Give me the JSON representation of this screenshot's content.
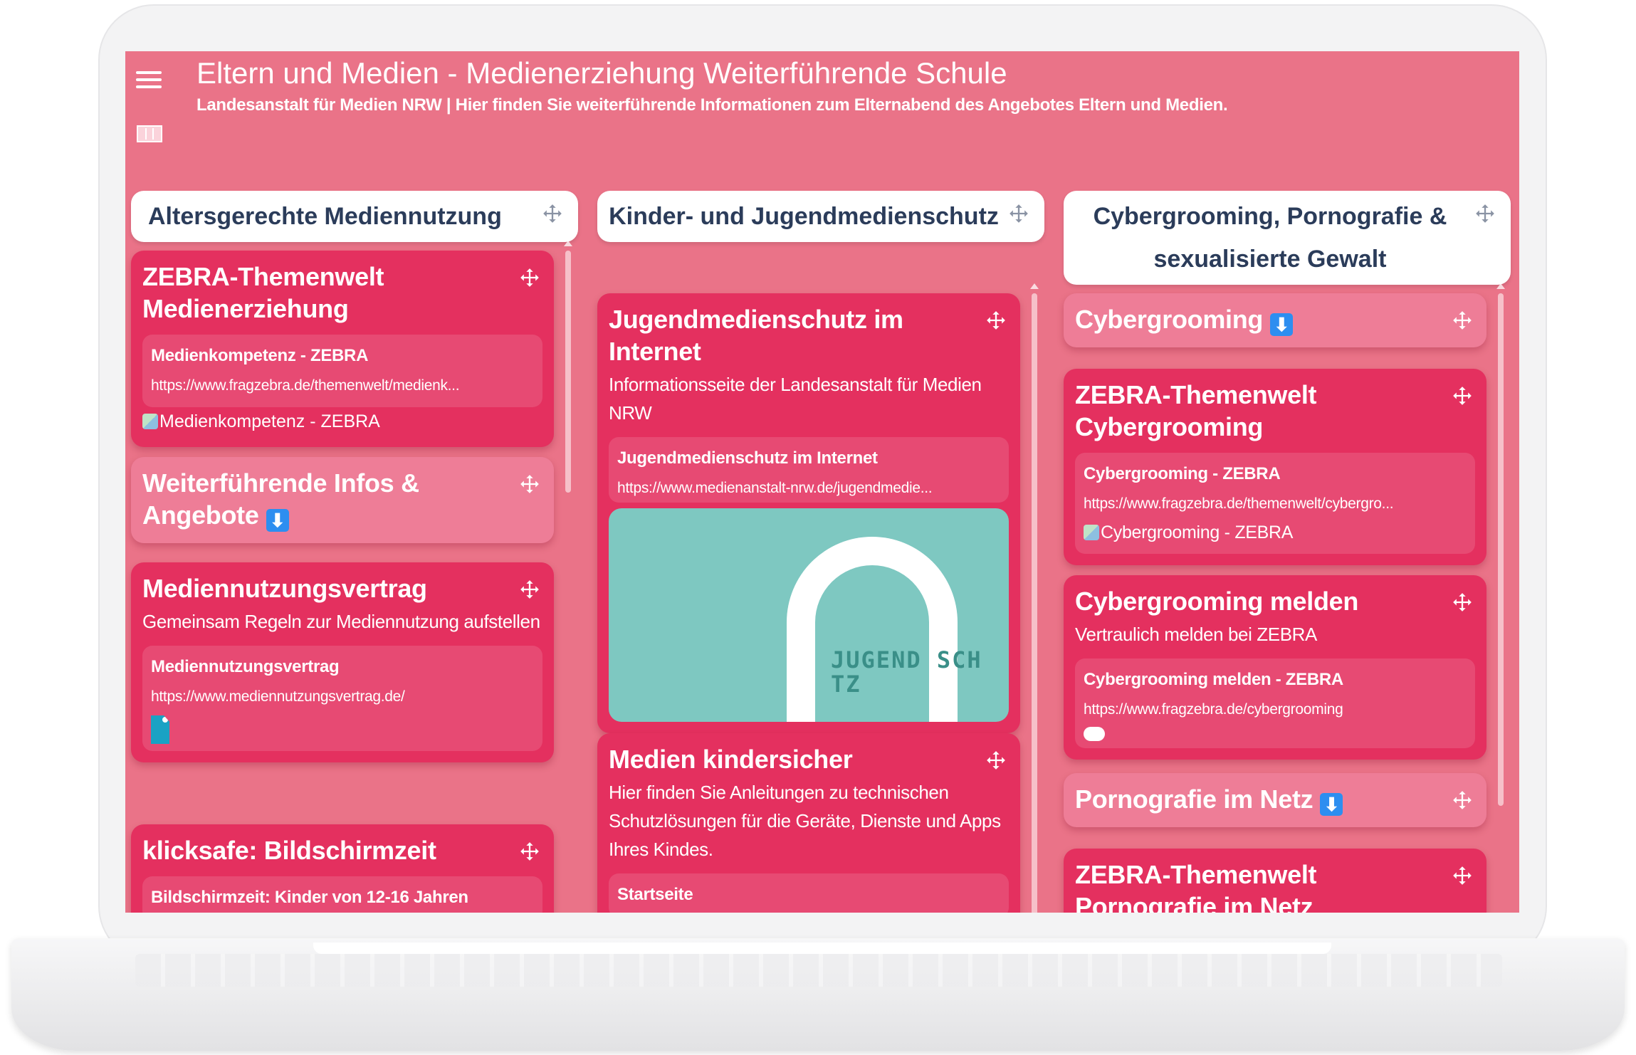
{
  "header": {
    "title": "Eltern und Medien - Medienerziehung Weiterführende Schule",
    "subtitle": "Landesanstalt für Medien NRW | Hier finden Sie weiterführende Informationen zum Elternabend des Angebotes Eltern und Medien."
  },
  "colors": {
    "background": "#ea7388",
    "card": "#e4305f",
    "card_light": "#ee7d97",
    "header_text": "#2b3c5a",
    "badge": "#2d8ef0"
  },
  "columns": [
    {
      "title": "Altersgerechte Mediennutzung",
      "cards": [
        {
          "title": "ZEBRA-Themenwelt Medienerziehung",
          "attachment": {
            "title": "Medienkompetenz - ZEBRA",
            "url": "https://www.fragzebra.de/themenwelt/medienk...",
            "image_alt": "Medienkompetenz - ZEBRA"
          }
        },
        {
          "title": "Weiterführende Infos & Angebote",
          "badge": "⬇"
        },
        {
          "title": "Mediennutzungsvertrag",
          "description": "Gemeinsam Regeln zur Mediennutzung aufstellen",
          "attachment": {
            "title": "Mediennutzungsvertrag",
            "url": "https://www.mediennutzungsvertrag.de/"
          }
        },
        {
          "title": "klicksafe: Bildschirmzeit",
          "attachment": {
            "title": "Bildschirmzeit: Kinder von 12-16 Jahren"
          }
        }
      ]
    },
    {
      "title": "Kinder- und Jugendmedienschutz",
      "cards": [
        {
          "title": "Jugendmedienschutz im Internet",
          "description": "Informationsseite der Landesanstalt für Medien NRW",
          "attachment": {
            "title": "Jugendmedienschutz im Internet",
            "url": "https://www.medienanstalt-nrw.de/jugendmedie...",
            "image_text": "JUGEND SCH TZ"
          }
        },
        {
          "title": "Medien kindersicher",
          "description": "Hier finden Sie Anleitungen zu technischen Schutzlösungen für die Geräte, Dienste und Apps Ihres Kindes.",
          "attachment": {
            "title": "Startseite"
          }
        }
      ]
    },
    {
      "title": "Cybergrooming, Pornografie & sexualisierte Gewalt",
      "cards": [
        {
          "title": "Cybergrooming",
          "badge": "⬇"
        },
        {
          "title": "ZEBRA-Themenwelt Cybergrooming",
          "attachment": {
            "title": "Cybergrooming - ZEBRA",
            "url": "https://www.fragzebra.de/themenwelt/cybergro...",
            "image_alt": "Cybergrooming - ZEBRA"
          }
        },
        {
          "title": "Cybergrooming melden",
          "description": "Vertraulich melden bei ZEBRA",
          "attachment": {
            "title": "Cybergrooming melden - ZEBRA",
            "url": "https://www.fragzebra.de/cybergrooming"
          }
        },
        {
          "title": "Pornografie im Netz",
          "badge": "⬇"
        },
        {
          "title": "ZEBRA-Themenwelt Pornografie im Netz"
        }
      ]
    }
  ]
}
